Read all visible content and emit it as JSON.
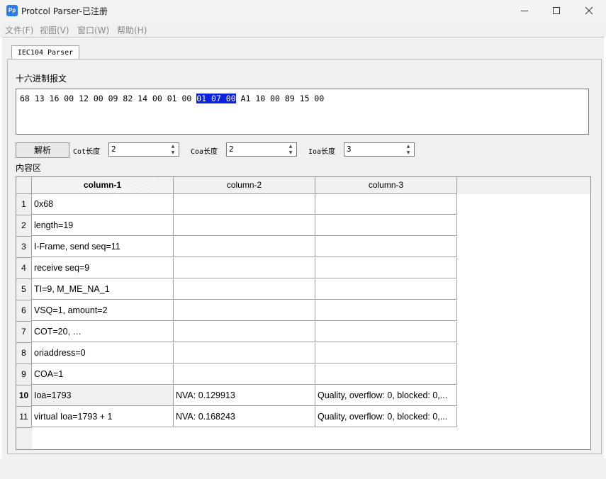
{
  "window": {
    "app_icon_text": "Pp",
    "title": "Protcol Parser-已注册"
  },
  "menu": [
    "文件(F)",
    "视图(V)",
    "窗口(W)",
    "帮助(H)"
  ],
  "tab_label": "IEC104 Parser",
  "hex_label": "十六进制报文",
  "hex": {
    "before": "68 13 16 00 12 00 09 82 14 00 01 00 ",
    "selected": "01 07 00",
    "after": " A1 10 00 89 15 00"
  },
  "parse_button": "解析",
  "cot_label": "Cot长度",
  "cot_value": "2",
  "coa_label": "Coa长度",
  "coa_value": "2",
  "ioa_label": "Ioa长度",
  "ioa_value": "3",
  "content_label": "内容区",
  "table": {
    "columns": [
      "column-1",
      "column-2",
      "column-3"
    ],
    "rows": [
      {
        "num": "1",
        "c1": "0x68",
        "c2": "",
        "c3": ""
      },
      {
        "num": "2",
        "c1": "length=19",
        "c2": "",
        "c3": ""
      },
      {
        "num": "3",
        "c1": "I-Frame, send seq=11",
        "c2": "",
        "c3": ""
      },
      {
        "num": "4",
        "c1": "receive seq=9",
        "c2": "",
        "c3": ""
      },
      {
        "num": "5",
        "c1": "TI=9, M_ME_NA_1",
        "c2": "",
        "c3": ""
      },
      {
        "num": "6",
        "c1": "VSQ=1, amount=2",
        "c2": "",
        "c3": ""
      },
      {
        "num": "7",
        "c1": "COT=20, …",
        "c2": "",
        "c3": ""
      },
      {
        "num": "8",
        "c1": "oriaddress=0",
        "c2": "",
        "c3": ""
      },
      {
        "num": "9",
        "c1": "COA=1",
        "c2": "",
        "c3": ""
      },
      {
        "num": "10",
        "c1": "Ioa=1793",
        "c2": "NVA: 0.129913",
        "c3": "Quality, overflow: 0, blocked: 0,..."
      },
      {
        "num": "11",
        "c1": "virtual Ioa=1793 + 1",
        "c2": "NVA: 0.168243",
        "c3": "Quality, overflow: 0, blocked: 0,..."
      }
    ]
  }
}
